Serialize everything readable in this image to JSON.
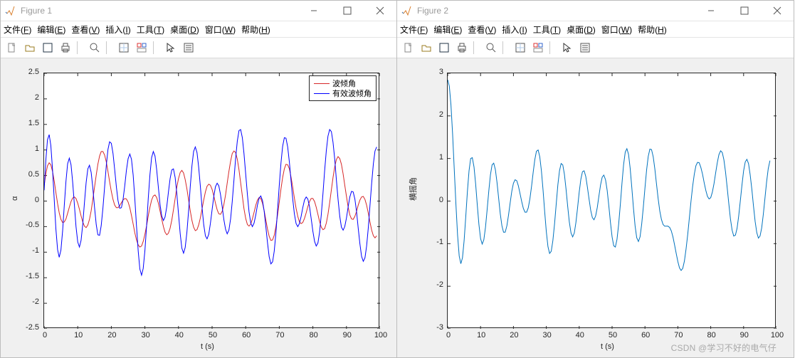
{
  "watermark": "CSDN @学习不好的电气仔",
  "figures": [
    {
      "title": "Figure 1",
      "menus": [
        "文件(F)",
        "编辑(E)",
        "查看(V)",
        "插入(I)",
        "工具(T)",
        "桌面(D)",
        "窗口(W)",
        "帮助(H)"
      ],
      "xlabel": "t (s)",
      "ylabel": "α",
      "legend": [
        "波倾角",
        "有效波倾角"
      ],
      "xticks": [
        0,
        10,
        20,
        30,
        40,
        50,
        60,
        70,
        80,
        90,
        100
      ],
      "yticks": [
        -2.5,
        -2,
        -1.5,
        -1,
        -0.5,
        0,
        0.5,
        1,
        1.5,
        2,
        2.5
      ],
      "colors": {
        "s1": "#d62728",
        "s2": "#0000ff"
      }
    },
    {
      "title": "Figure 2",
      "menus": [
        "文件(F)",
        "编辑(E)",
        "查看(V)",
        "插入(I)",
        "工具(T)",
        "桌面(D)",
        "窗口(W)",
        "帮助(H)"
      ],
      "xlabel": "t (s)",
      "ylabel": "横摇角",
      "legend": [],
      "xticks": [
        0,
        10,
        20,
        30,
        40,
        50,
        60,
        70,
        80,
        90,
        100
      ],
      "yticks": [
        -3,
        -2,
        -1,
        0,
        1,
        2,
        3
      ],
      "colors": {
        "s1": "#0072bd"
      }
    }
  ],
  "chart_data": [
    {
      "type": "line",
      "title": "Figure 1",
      "xlabel": "t (s)",
      "ylabel": "α",
      "xlim": [
        0,
        100
      ],
      "ylim": [
        -2.5,
        2.5
      ],
      "x_step": 0.5,
      "legend_position": "top-right",
      "series": [
        {
          "name": "波倾角",
          "color": "#d62728",
          "values": [
            0.3,
            0.53,
            0.69,
            0.75,
            0.71,
            0.58,
            0.39,
            0.17,
            -0.05,
            -0.23,
            -0.36,
            -0.42,
            -0.41,
            -0.35,
            -0.24,
            -0.12,
            -0.01,
            0.06,
            0.08,
            0.05,
            -0.04,
            -0.16,
            -0.29,
            -0.41,
            -0.49,
            -0.52,
            -0.47,
            -0.36,
            -0.19,
            0.03,
            0.27,
            0.51,
            0.72,
            0.88,
            0.97,
            0.97,
            0.9,
            0.77,
            0.58,
            0.38,
            0.19,
            0.03,
            -0.08,
            -0.13,
            -0.13,
            -0.09,
            -0.03,
            0.02,
            0.05,
            0.04,
            -0.02,
            -0.13,
            -0.28,
            -0.45,
            -0.62,
            -0.76,
            -0.86,
            -0.9,
            -0.88,
            -0.79,
            -0.65,
            -0.48,
            -0.29,
            -0.12,
            0.02,
            0.1,
            0.12,
            0.07,
            -0.04,
            -0.19,
            -0.35,
            -0.5,
            -0.61,
            -0.66,
            -0.63,
            -0.53,
            -0.37,
            -0.17,
            0.05,
            0.27,
            0.44,
            0.56,
            0.6,
            0.55,
            0.42,
            0.24,
            0.02,
            -0.19,
            -0.38,
            -0.51,
            -0.58,
            -0.56,
            -0.47,
            -0.33,
            -0.16,
            0.02,
            0.18,
            0.29,
            0.33,
            0.31,
            0.23,
            0.1,
            -0.04,
            -0.17,
            -0.25,
            -0.26,
            -0.2,
            -0.07,
            0.12,
            0.35,
            0.58,
            0.78,
            0.93,
            0.98,
            0.95,
            0.82,
            0.61,
            0.36,
            0.1,
            -0.15,
            -0.34,
            -0.46,
            -0.49,
            -0.45,
            -0.35,
            -0.22,
            -0.08,
            0.02,
            0.07,
            0.05,
            -0.04,
            -0.19,
            -0.37,
            -0.55,
            -0.69,
            -0.77,
            -0.76,
            -0.67,
            -0.5,
            -0.27,
            -0.02,
            0.24,
            0.46,
            0.63,
            0.72,
            0.71,
            0.63,
            0.47,
            0.27,
            0.06,
            -0.14,
            -0.3,
            -0.41,
            -0.44,
            -0.42,
            -0.34,
            -0.23,
            -0.11,
            -0.01,
            0.05,
            0.05,
            -0.01,
            -0.12,
            -0.26,
            -0.4,
            -0.51,
            -0.56,
            -0.54,
            -0.43,
            -0.26,
            -0.03,
            0.22,
            0.46,
            0.67,
            0.81,
            0.87,
            0.83,
            0.72,
            0.53,
            0.31,
            0.09,
            -0.12,
            -0.27,
            -0.35,
            -0.36,
            -0.3,
            -0.2,
            -0.08,
            0.02,
            0.08,
            0.09,
            0.03,
            -0.08,
            -0.24,
            -0.41,
            -0.57,
            -0.68,
            -0.72,
            -0.68
          ]
        },
        {
          "name": "有效波倾角",
          "color": "#0000ff",
          "values": [
            0.21,
            0.8,
            1.2,
            1.3,
            1.09,
            0.62,
            0.03,
            -0.54,
            -0.95,
            -1.1,
            -0.96,
            -0.58,
            -0.09,
            0.39,
            0.73,
            0.84,
            0.71,
            0.37,
            -0.07,
            -0.5,
            -0.8,
            -0.9,
            -0.77,
            -0.45,
            -0.04,
            0.36,
            0.63,
            0.7,
            0.56,
            0.26,
            -0.12,
            -0.46,
            -0.66,
            -0.67,
            -0.48,
            -0.14,
            0.28,
            0.69,
            1.01,
            1.16,
            1.13,
            0.93,
            0.62,
            0.28,
            0.01,
            -0.14,
            -0.13,
            0.03,
            0.3,
            0.6,
            0.83,
            0.92,
            0.82,
            0.51,
            0.05,
            -0.49,
            -0.98,
            -1.33,
            -1.45,
            -1.32,
            -0.97,
            -0.48,
            0.05,
            0.52,
            0.85,
            0.97,
            0.88,
            0.62,
            0.27,
            -0.06,
            -0.29,
            -0.38,
            -0.31,
            -0.11,
            0.17,
            0.44,
            0.61,
            0.63,
            0.46,
            0.15,
            -0.25,
            -0.64,
            -0.92,
            -1.02,
            -0.91,
            -0.61,
            -0.19,
            0.28,
            0.69,
            0.97,
            1.06,
            0.95,
            0.67,
            0.29,
            -0.11,
            -0.46,
            -0.68,
            -0.74,
            -0.65,
            -0.44,
            -0.17,
            0.09,
            0.28,
            0.35,
            0.3,
            0.13,
            -0.11,
            -0.36,
            -0.55,
            -0.64,
            -0.57,
            -0.35,
            -0.01,
            0.41,
            0.83,
            1.17,
            1.38,
            1.4,
            1.24,
            0.93,
            0.53,
            0.13,
            -0.21,
            -0.43,
            -0.5,
            -0.43,
            -0.27,
            -0.08,
            0.06,
            0.1,
            0.01,
            -0.2,
            -0.5,
            -0.82,
            -1.09,
            -1.23,
            -1.19,
            -0.98,
            -0.62,
            -0.17,
            0.31,
            0.75,
            1.07,
            1.24,
            1.23,
            1.06,
            0.76,
            0.4,
            0.04,
            -0.25,
            -0.44,
            -0.5,
            -0.44,
            -0.3,
            -0.13,
            0.02,
            0.08,
            0.04,
            -0.11,
            -0.34,
            -0.59,
            -0.79,
            -0.88,
            -0.82,
            -0.61,
            -0.27,
            0.15,
            0.59,
            0.99,
            1.27,
            1.4,
            1.36,
            1.15,
            0.82,
            0.42,
            0.03,
            -0.3,
            -0.51,
            -0.57,
            -0.5,
            -0.33,
            -0.11,
            0.08,
            0.19,
            0.18,
            0.04,
            -0.21,
            -0.53,
            -0.84,
            -1.08,
            -1.18,
            -1.11,
            -0.88,
            -0.52,
            -0.09,
            0.35,
            0.73,
            0.98,
            1.06
          ]
        }
      ]
    },
    {
      "type": "line",
      "title": "Figure 2",
      "xlabel": "t (s)",
      "ylabel": "横摇角",
      "xlim": [
        0,
        100
      ],
      "ylim": [
        -3,
        3
      ],
      "x_step": 0.5,
      "series": [
        {
          "name": "横摇角",
          "color": "#0072bd",
          "values": [
            2.85,
            2.7,
            2.26,
            1.58,
            0.76,
            -0.08,
            -0.8,
            -1.29,
            -1.47,
            -1.33,
            -0.93,
            -0.37,
            0.22,
            0.71,
            1.0,
            1.02,
            0.8,
            0.4,
            -0.09,
            -0.55,
            -0.88,
            -1.01,
            -0.91,
            -0.62,
            -0.21,
            0.24,
            0.62,
            0.85,
            0.89,
            0.74,
            0.44,
            0.07,
            -0.3,
            -0.58,
            -0.73,
            -0.73,
            -0.58,
            -0.33,
            -0.04,
            0.23,
            0.42,
            0.5,
            0.48,
            0.36,
            0.18,
            -0.01,
            -0.17,
            -0.26,
            -0.26,
            -0.16,
            0.05,
            0.34,
            0.67,
            0.97,
            1.17,
            1.2,
            1.04,
            0.71,
            0.26,
            -0.25,
            -0.72,
            -1.07,
            -1.23,
            -1.18,
            -0.93,
            -0.53,
            -0.07,
            0.38,
            0.71,
            0.88,
            0.85,
            0.63,
            0.28,
            -0.12,
            -0.49,
            -0.75,
            -0.84,
            -0.75,
            -0.5,
            -0.16,
            0.21,
            0.51,
            0.69,
            0.71,
            0.58,
            0.33,
            0.04,
            -0.22,
            -0.39,
            -0.44,
            -0.35,
            -0.15,
            0.12,
            0.38,
            0.56,
            0.61,
            0.5,
            0.25,
            -0.11,
            -0.5,
            -0.84,
            -1.05,
            -1.08,
            -0.9,
            -0.55,
            -0.08,
            0.42,
            0.86,
            1.15,
            1.23,
            1.1,
            0.77,
            0.32,
            -0.16,
            -0.58,
            -0.86,
            -0.95,
            -0.84,
            -0.54,
            -0.14,
            0.31,
            0.73,
            1.05,
            1.22,
            1.21,
            1.04,
            0.75,
            0.4,
            0.06,
            -0.23,
            -0.43,
            -0.55,
            -0.59,
            -0.59,
            -0.59,
            -0.62,
            -0.7,
            -0.84,
            -1.03,
            -1.23,
            -1.42,
            -1.57,
            -1.63,
            -1.58,
            -1.41,
            -1.13,
            -0.78,
            -0.39,
            -0.0,
            0.35,
            0.63,
            0.83,
            0.91,
            0.9,
            0.79,
            0.63,
            0.43,
            0.25,
            0.11,
            0.05,
            0.08,
            0.21,
            0.41,
            0.66,
            0.9,
            1.09,
            1.18,
            1.14,
            0.97,
            0.68,
            0.32,
            -0.06,
            -0.42,
            -0.68,
            -0.82,
            -0.8,
            -0.64,
            -0.35,
            0.01,
            0.38,
            0.71,
            0.92,
            0.98,
            0.88,
            0.62,
            0.27,
            -0.12,
            -0.48,
            -0.74,
            -0.87,
            -0.82,
            -0.63,
            -0.31,
            0.07,
            0.45,
            0.76,
            0.95
          ]
        }
      ]
    }
  ]
}
